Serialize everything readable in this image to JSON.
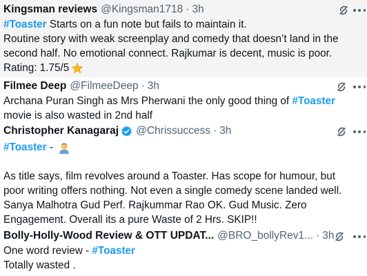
{
  "tweets": [
    {
      "name": "Kingsman reviews",
      "handle": "@Kingsman1718",
      "separator": "·",
      "time": "3h",
      "hashtag": "#Toaster",
      "text_after_hashtag": " Starts on a fun note but fails to maintain it.",
      "line2": "Routine story with weak screenplay and comedy that doesn’t land in the",
      "line3": "second half. No emotional connect. Rajkumar is decent, music is poor.",
      "rating": "Rating: 1.75/5",
      "emoji": "star"
    },
    {
      "name": "Filmee Deep",
      "handle": "@FilmeeDeep",
      "separator": "·",
      "time": "3h",
      "text_before_hashtag": "Archana Puran Singh as Mrs Pherwani the only good thing of ",
      "hashtag": "#Toaster",
      "line2": "movie is also wasted in 2nd half"
    },
    {
      "name": "Christopher Kanagaraj",
      "handle": "@Chrissuccess",
      "separator": "·",
      "time": "3h",
      "hashtag": "#Toaster",
      "after_hashtag": " - ",
      "emoji": "facepalm",
      "lines": [
        "As title says, film revolves around a Toaster. Has scope for humour, but",
        "poor writing offers nothing. Not even a single comedy scene landed well.",
        "Sanya Malhotra Gud Perf. Rajkummar Rao OK. Gud Music. Zero",
        "Engagement. Overall its a pure Waste of 2 Hrs. SKIP!!"
      ]
    },
    {
      "name": "Bolly-Holly-Wood Review & OTT UPDAT...",
      "handle": "@BRO_bollyRev1...",
      "separator": "·",
      "time": "3h",
      "text_before_hashtag": "One word review - ",
      "hashtag": "#Toaster",
      "line2": "Totally wasted ."
    }
  ],
  "icons": {
    "grok": "grok-icon",
    "more": "more-options-icon",
    "verified": "verified-badge-icon"
  },
  "colors": {
    "hashtag": "#1d9bf0",
    "muted": "#536471",
    "verified": "#1d9bf0",
    "highlight_bg": "#f4f4f4"
  }
}
